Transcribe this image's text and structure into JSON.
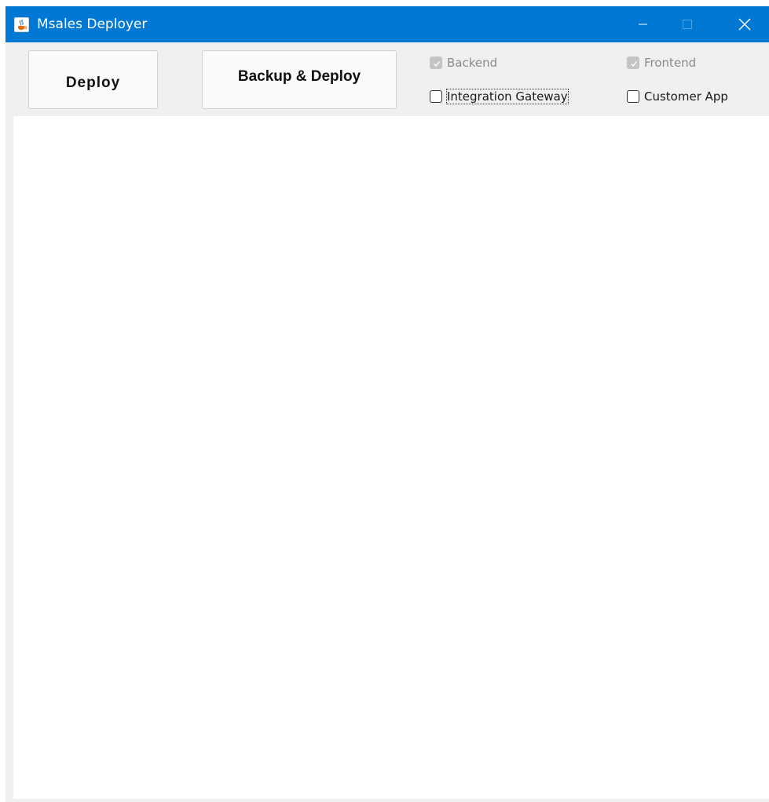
{
  "window": {
    "title": "Msales Deployer",
    "app_icon": "java-cup-icon",
    "title_bar_color": "#0078d4",
    "controls": [
      "minimize-icon",
      "maximize-icon",
      "close-icon"
    ]
  },
  "toolbar": {
    "deploy_label": "Deploy",
    "backup_deploy_label": "Backup & Deploy"
  },
  "options": {
    "backend": {
      "label": "Backend",
      "checked": true,
      "enabled": false
    },
    "frontend": {
      "label": "Frontend",
      "checked": true,
      "enabled": false
    },
    "integration_gateway": {
      "label": "Integration Gateway",
      "checked": false,
      "enabled": true,
      "focused": true
    },
    "customer_app": {
      "label": "Customer App",
      "checked": false,
      "enabled": true
    }
  }
}
